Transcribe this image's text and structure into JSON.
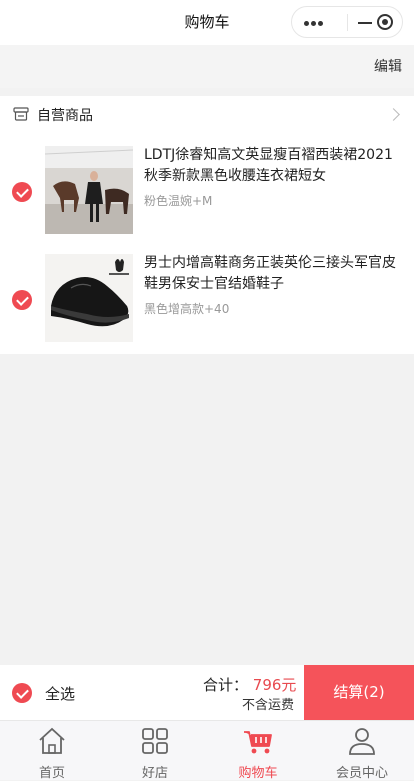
{
  "header": {
    "title": "购物车"
  },
  "edit_label": "编辑",
  "shop": {
    "name": "自营商品"
  },
  "items": [
    {
      "name": "LDTJ徐睿知高文英显瘦百褶西装裙2021秋季新款黑色收腰连衣裙短女",
      "spec": "粉色温婉+M",
      "checked": true
    },
    {
      "name": "男士内增高鞋商务正装英伦三接头军官皮鞋男保安士官结婚鞋子",
      "spec": "黑色增高款+40",
      "checked": true
    }
  ],
  "checkout": {
    "select_all": "全选",
    "total_label": "合计：",
    "total_value": "796元",
    "freight": "不含运费",
    "pay_button": "结算(2)"
  },
  "tabs": [
    {
      "label": "首页",
      "icon": "home-icon"
    },
    {
      "label": "好店",
      "icon": "grid-icon"
    },
    {
      "label": "购物车",
      "icon": "cart-icon",
      "active": true
    },
    {
      "label": "会员中心",
      "icon": "user-icon"
    }
  ],
  "colors": {
    "accent": "#ef4a52",
    "pay_button": "#f5535a",
    "price": "#e84a4f"
  }
}
